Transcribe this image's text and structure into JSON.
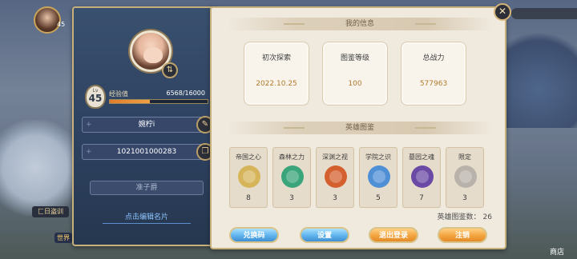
{
  "colors": {
    "accent_gold": "#c8b07a",
    "panel_blue": "#2d4160",
    "paper": "#efe9de",
    "value_text": "#b27a2d",
    "exp_fill": "#e27c2a",
    "link_blue": "#8ec5ff",
    "button_blue": "#5fb3ec",
    "button_orange": "#f3a43f"
  },
  "hud": {
    "level": "45",
    "goto_label": "匚日盗训",
    "left_tag": "世界",
    "shop_label": "商店"
  },
  "profile": {
    "avatar_icon": "player-avatar-icon",
    "swap_icon": "swap-icon",
    "level_label": "Lv",
    "level": "45",
    "exp_label": "经验值",
    "exp_text": "6568/16000",
    "exp_ratio": 0.4105,
    "name": "婉柠i",
    "name_edit_icon": "pencil-icon",
    "player_id": "1021001000283",
    "id_copy_icon": "copy-icon",
    "title": "准子爵",
    "edit_card_link": "点击编辑名片"
  },
  "info_section": {
    "title": "我的信息",
    "stats": [
      {
        "label": "初次探索",
        "value": "2022.10.25"
      },
      {
        "label": "图鉴等级",
        "value": "100"
      },
      {
        "label": "总战力",
        "value": "577963"
      }
    ]
  },
  "heroes_section": {
    "title": "英雄图鉴",
    "cards": [
      {
        "label": "帝国之心",
        "count": "8",
        "emblem_icon": "empire-heart-emblem-icon",
        "color": "#d6b55a"
      },
      {
        "label": "森林之力",
        "count": "3",
        "emblem_icon": "forest-power-emblem-icon",
        "color": "#3aa57a"
      },
      {
        "label": "深渊之视",
        "count": "3",
        "emblem_icon": "abyss-sight-emblem-icon",
        "color": "#d4602f"
      },
      {
        "label": "学院之识",
        "count": "5",
        "emblem_icon": "academy-knowledge-emblem-icon",
        "color": "#4f8fd6"
      },
      {
        "label": "墓园之魂",
        "count": "7",
        "emblem_icon": "graveyard-soul-emblem-icon",
        "color": "#6b4aa6"
      },
      {
        "label": "限定",
        "count": "3",
        "emblem_icon": "limited-emblem-icon",
        "color": "#b8b2aa"
      }
    ],
    "total_label": "英雄图鉴数：",
    "total_value": "26"
  },
  "buttons": {
    "redeem": "兑换码",
    "settings": "设置",
    "logout": "退出登录",
    "cancel_account": "注销"
  },
  "close_icon": "close-icon"
}
